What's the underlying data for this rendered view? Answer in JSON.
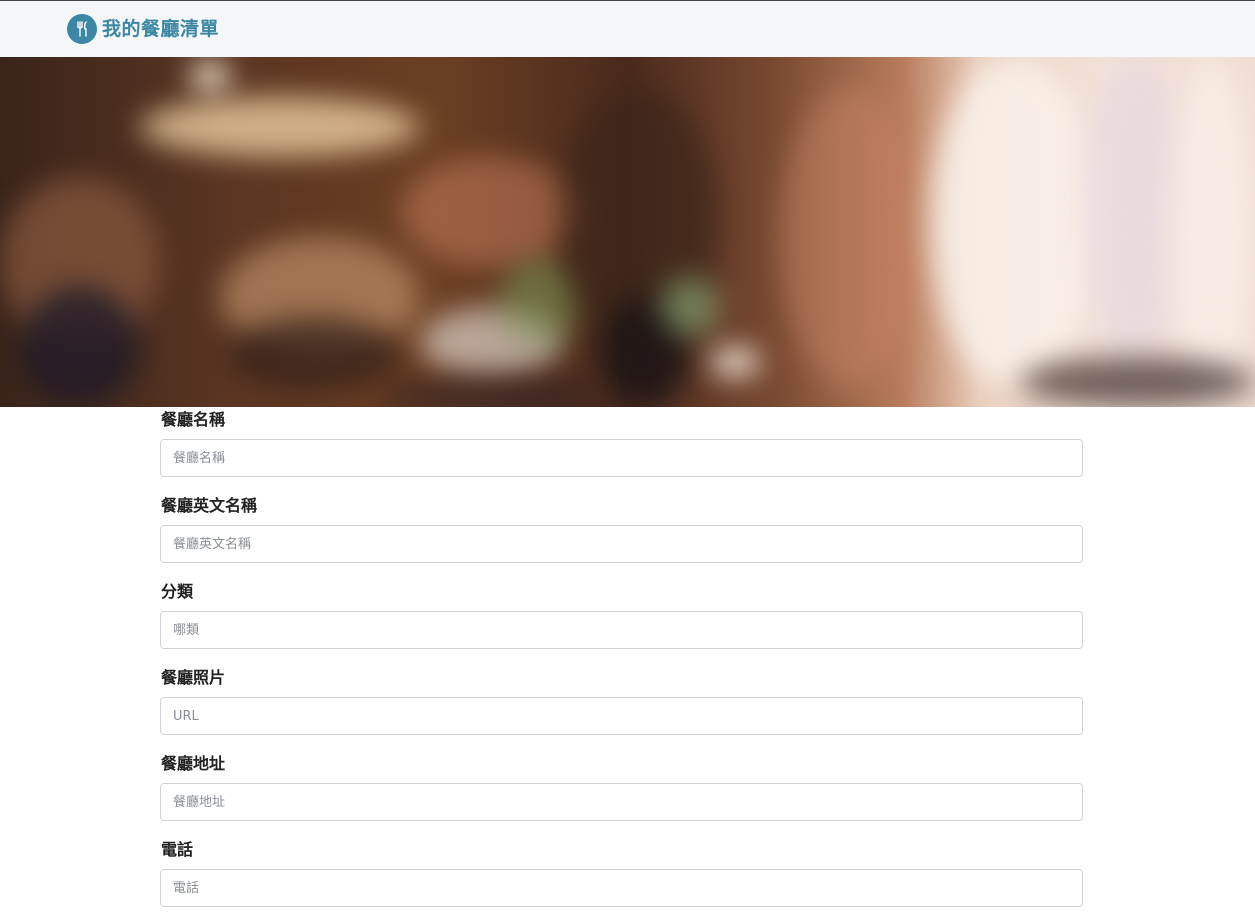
{
  "navbar": {
    "brand_icon": "utensils-icon",
    "brand_title": "我的餐廳清單"
  },
  "hero": {
    "image": "blurred-restaurant-interior-photo"
  },
  "form": {
    "fields": [
      {
        "label": "餐廳名稱",
        "placeholder": "餐廳名稱"
      },
      {
        "label": "餐廳英文名稱",
        "placeholder": "餐廳英文名稱"
      },
      {
        "label": "分類",
        "placeholder": "哪類"
      },
      {
        "label": "餐廳照片",
        "placeholder": "URL"
      },
      {
        "label": "餐廳地址",
        "placeholder": "餐廳地址"
      },
      {
        "label": "電話",
        "placeholder": "電話"
      }
    ]
  },
  "colors": {
    "brand": "#3c87a5",
    "navbar_bg": "#f5f6f8"
  }
}
